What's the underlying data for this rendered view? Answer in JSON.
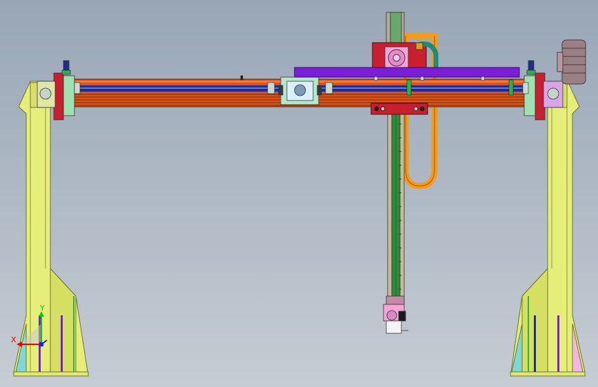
{
  "viewport": {
    "background_top": "#98a6b6",
    "background_bottom": "#c6ccd3"
  },
  "triad": {
    "x_label": "X",
    "y_label": "Y",
    "x_color": "#e60000",
    "y_color": "#00cc00",
    "z_color": "#1a1aff"
  },
  "colors": {
    "column_fill": "#e6ee7a",
    "column_stroke": "#6e7230",
    "beam_orange": "#d9541a",
    "beam_blue": "#1d2f8c",
    "purple_bar": "#7a1fd6",
    "cable_orange": "#f59a1c",
    "vertical_green": "#2e8b3a",
    "red_carriage": "#c8202e",
    "pink_gear": "#f2a6d8",
    "teal_hose": "#1f8a7a",
    "motor_gray": "#9a7f84"
  }
}
